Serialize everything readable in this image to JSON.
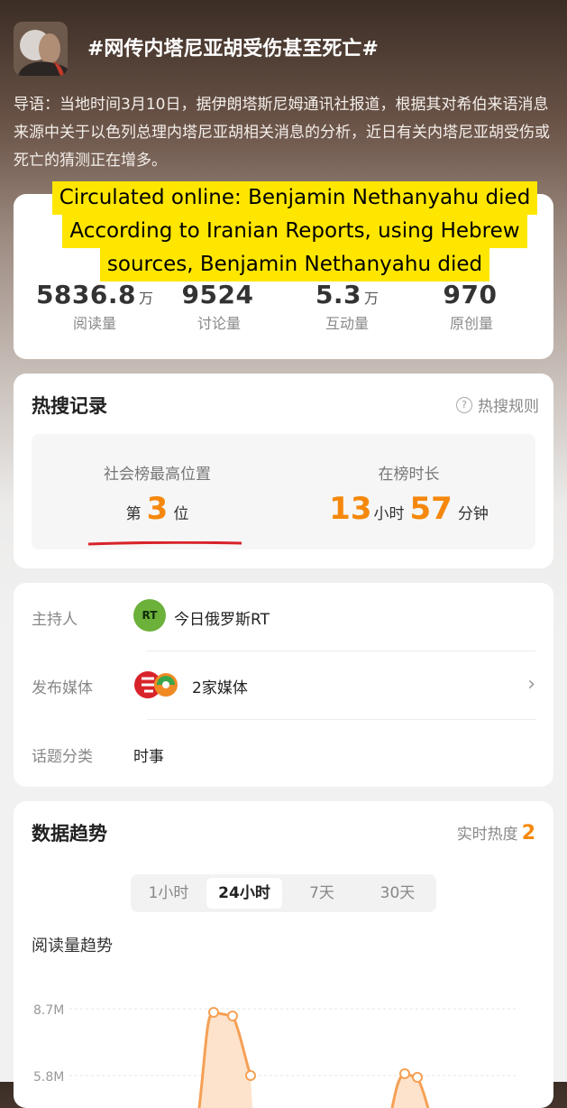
{
  "header": {
    "title": "#网传内塔尼亚胡受伤甚至死亡#"
  },
  "intro_text": "导语：当地时间3月10日，据伊朗塔斯尼姆通讯社报道，根据其对希伯来语消息来源中关于以色列总理内塔尼亚胡相关消息的分析，近日有关内塔尼亚胡受伤或死亡的猜测正在增多。",
  "overlay": {
    "line1": "Circulated online: Benjamin Nethanyahu died",
    "line2": "According to Iranian Reports, using Hebrew",
    "line3": "sources, Benjamin Nethanyahu died"
  },
  "stats": [
    {
      "value": "5836.8",
      "unit": "万",
      "label": "阅读量"
    },
    {
      "value": "9524",
      "unit": "",
      "label": "讨论量"
    },
    {
      "value": "5.3",
      "unit": "万",
      "label": "互动量"
    },
    {
      "value": "970",
      "unit": "",
      "label": "原创量"
    }
  ],
  "hot_search": {
    "title": "热搜记录",
    "rule_label": "热搜规则",
    "rule_icon": "question-circle-icon",
    "highest_label": "社会榜最高位置",
    "rank_prefix": "第",
    "rank_value": "3",
    "rank_suffix": "位",
    "duration_label": "在榜时长",
    "hours_value": "13",
    "hours_unit": "小时",
    "minutes_value": "57",
    "minutes_unit": "分钟",
    "highlight_color": "#f5880c"
  },
  "info": {
    "host_label": "主持人",
    "host_value": "今日俄罗斯RT",
    "host_logo_text": "RT",
    "media_label": "发布媒体",
    "media_value": "2家媒体",
    "category_label": "话题分类",
    "category_value": "时事"
  },
  "trend": {
    "title": "数据趋势",
    "realtime_label": "实时热度",
    "realtime_value": "2",
    "tabs": [
      "1小时",
      "24小时",
      "7天",
      "30天"
    ],
    "active_tab": "24小时",
    "chart_title": "阅读量趋势"
  },
  "chart_data": {
    "type": "area",
    "y_ticks": [
      "8.7M",
      "5.8M"
    ],
    "series_color": "#f5880c"
  }
}
